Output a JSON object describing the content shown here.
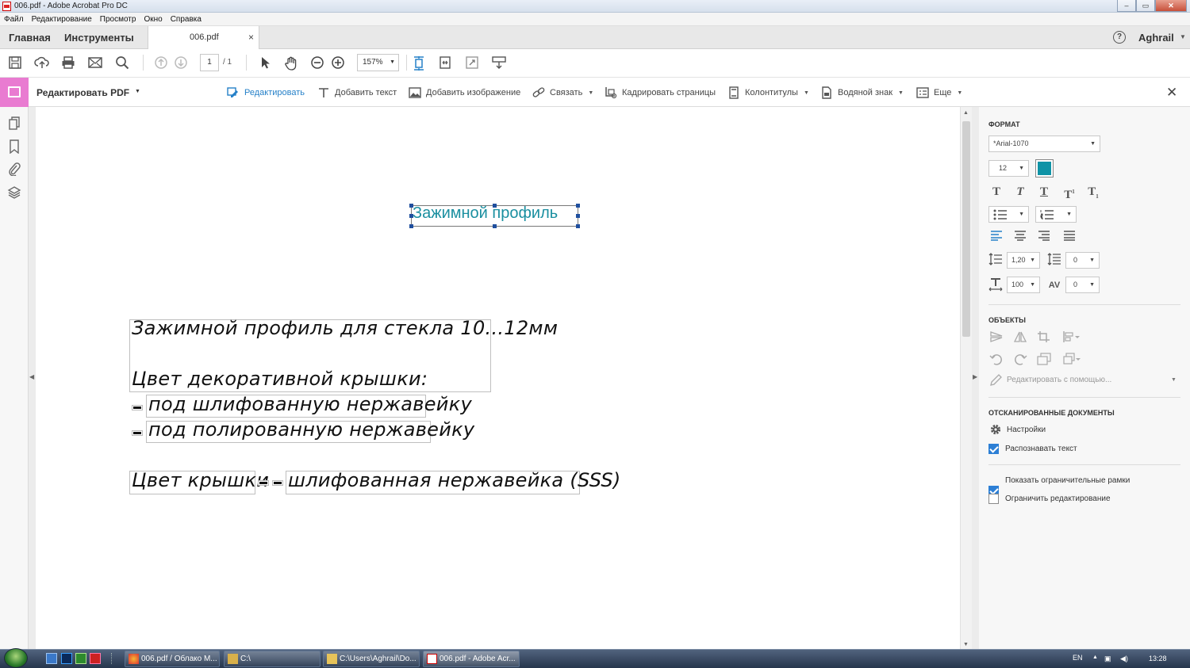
{
  "window": {
    "title": "006.pdf - Adobe Acrobat Pro DC",
    "controls": [
      "–",
      "▭",
      "✕"
    ]
  },
  "menu": [
    "Файл",
    "Редактирование",
    "Просмотр",
    "Окно",
    "Справка"
  ],
  "tabs": {
    "home": "Главная",
    "tools": "Инструменты",
    "doc": "006.pdf",
    "doc_close": "×"
  },
  "account": {
    "help": "?",
    "user": "Aghrail",
    "caret": "▼"
  },
  "toolbar": {
    "page_current": "1",
    "page_total": "/  1",
    "zoom": "157%",
    "zoom_caret": "▼",
    "icons": [
      "save-icon",
      "upload-icon",
      "print-icon",
      "email-icon",
      "search-icon",
      "prev-page-icon",
      "next-page-icon",
      "select-arrow-icon",
      "hand-icon",
      "zoom-out-icon",
      "zoom-in-icon",
      "fit-page-icon",
      "fit-width-icon",
      "full-screen-icon",
      "read-mode-icon"
    ]
  },
  "edit_toolbar": {
    "title": "Редактировать PDF",
    "title_caret": "▼",
    "edit": "Редактировать",
    "add_text": "Добавить текст",
    "add_image": "Добавить изображение",
    "link": "Связать",
    "crop": "Кадрировать страницы",
    "headers": "Колонтитулы",
    "watermark": "Водяной знак",
    "more": "Еще",
    "caret": "▼",
    "close": "✕"
  },
  "document": {
    "heading": "Зажимной профиль",
    "line1": "Зажимной профиль для стекла 10...12мм",
    "line2": "Цвет декоративной крышки:",
    "option1": "под шлифованную нержавейку",
    "option2": "под полированную нержавейку",
    "color_label": "Цвет крышки",
    "color_value": "шлифованная нержавейка (SSS)"
  },
  "format_panel": {
    "section_format": "ФОРМАТ",
    "font": "*Arial-1070",
    "font_size": "12",
    "text_color": "#0f93a6",
    "line_spacing": "1,20",
    "paragraph_spacing": "0",
    "horizontal_scale": "100",
    "char_spacing": "0",
    "caret": "▼",
    "section_objects": "ОБЪЕКТЫ",
    "edit_with": "Редактировать с помощью...",
    "section_scanned": "ОТСКАНИРОВАННЫЕ ДОКУМЕНТЫ",
    "settings": "Настройки",
    "recognize_text": "Распознавать текст",
    "recognize_checked": true,
    "show_bounding": "Показать ограничительные рамки",
    "show_bounding_checked": true,
    "restrict_editing": "Ограничить редактирование",
    "restrict_checked": false
  },
  "taskbar": {
    "items": [
      {
        "label": "006.pdf / Облако M..."
      },
      {
        "label": "C:\\"
      },
      {
        "label": "C:\\Users\\Aghrail\\Do..."
      },
      {
        "label": "006.pdf - Adobe Acr..."
      }
    ],
    "lang": "EN",
    "time": "13:28"
  }
}
